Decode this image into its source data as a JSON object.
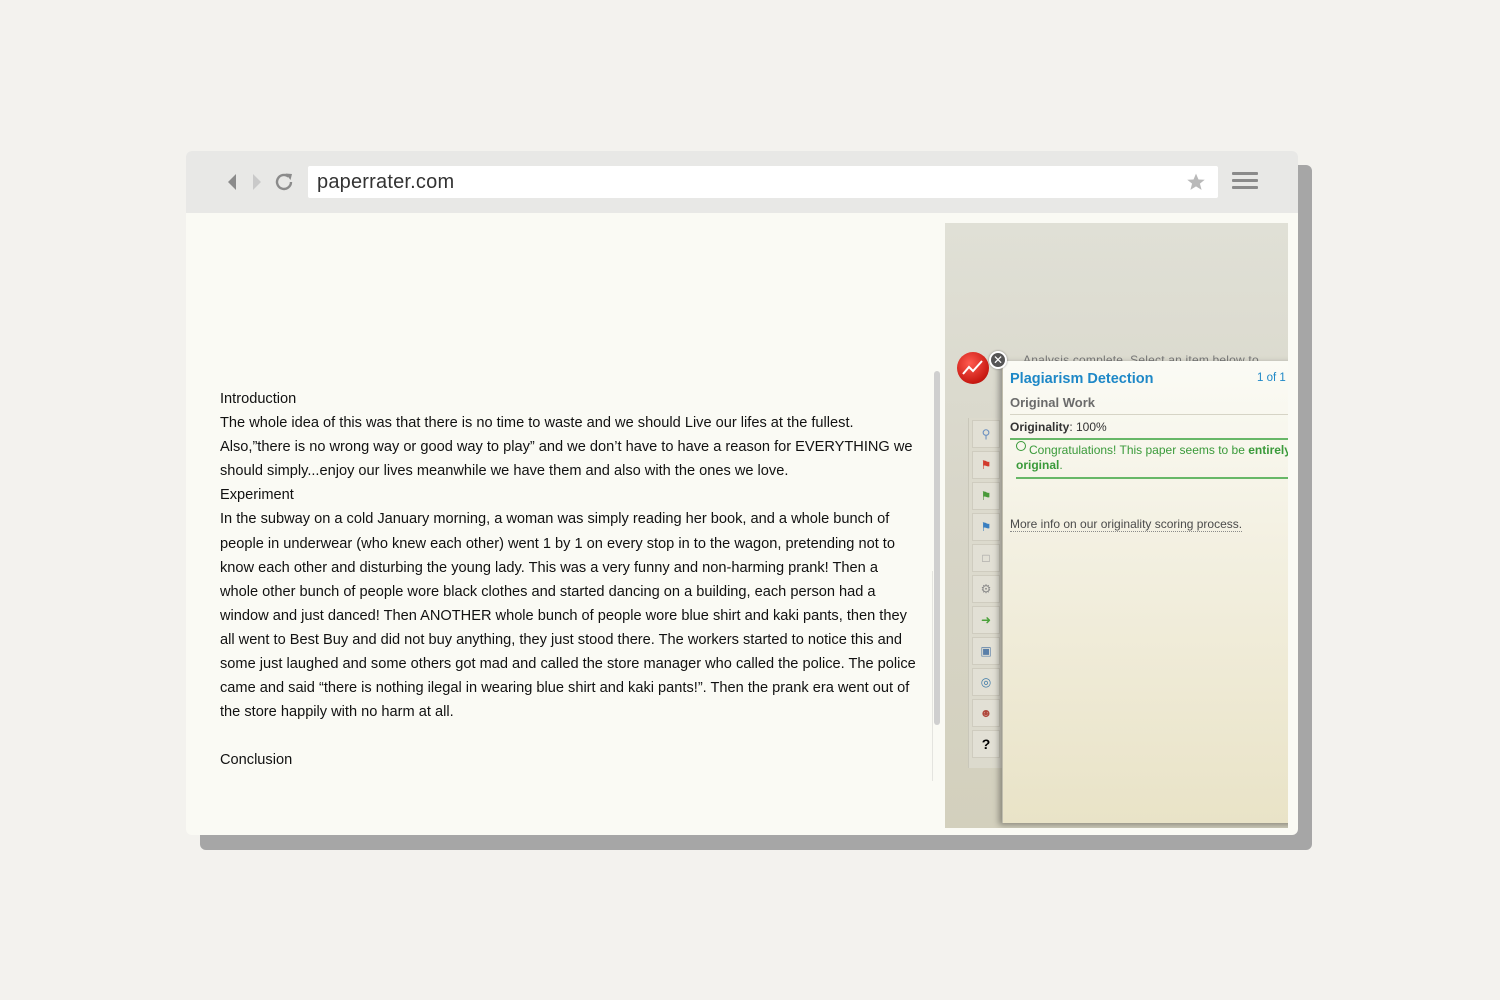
{
  "browser": {
    "url": "paperrater.com"
  },
  "document": {
    "paragraphs": [
      "Introduction",
      "The whole idea of this was that there is no time to waste and we should Live our lifes at the fullest.",
      "Also,”there is no wrong way or good way to play” and we don’t have to have a reason for EVERYTHING we should simply...enjoy our lives meanwhile we have them and also with the ones we love.",
      "Experiment",
      "In the subway on a cold January morning, a woman was simply reading her book, and a whole bunch of people in underwear (who knew each other) went 1 by 1 on every stop in to the wagon, pretending not to know each other and disturbing the young lady. This was a very funny and non-harming prank! Then a whole other bunch of people wore black clothes and started dancing on a building, each person had a window and just danced! Then ANOTHER whole bunch of people wore blue shirt and kaki pants, then they all went to Best Buy and did not buy anything, they just stood there. The workers started to notice this and some just laughed and some others got mad and called the store manager who called the police. The police came and said “there is nothing ilegal in wearing blue shirt and kaki pants!”. Then the prank era went out of the store happily with no harm at all.",
      "Conclusion"
    ]
  },
  "panel": {
    "ghost_text": "Analysis complete. Select an item below to",
    "title": "Plagiarism Detection",
    "count": "1 of 1",
    "section": "Original Work",
    "originality_label": "Originality",
    "originality_value": ": 100%",
    "congrats_text": "Congratulations! This paper seems to be",
    "congrats_bold": "entirely original",
    "congrats_end": ".",
    "more_info": "More info on our originality scoring process.",
    "help_label": "?"
  }
}
